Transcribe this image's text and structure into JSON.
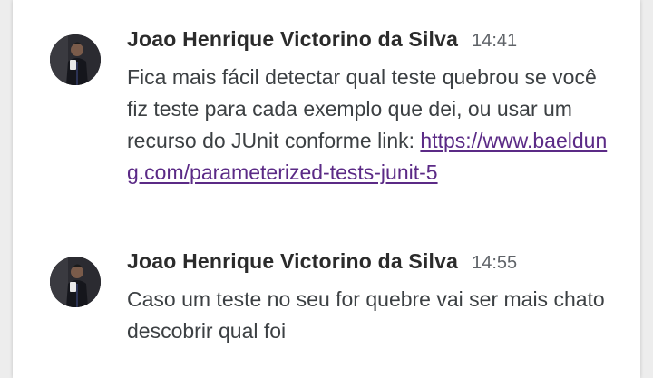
{
  "messages": [
    {
      "author": "Joao Henrique Victorino da Silva",
      "time": "14:41",
      "text": "Fica mais fácil detectar qual teste quebrou se você fiz teste para cada exemplo que dei, ou usar um recurso do JUnit conforme link: ",
      "link": "https://www.baeldung.com/parameterized-tests-junit-5",
      "avatar": "user-avatar"
    },
    {
      "author": "Joao Henrique Victorino da Silva",
      "time": "14:55",
      "text": "Caso um teste no seu for quebre vai ser mais chato descobrir qual foi",
      "avatar": "user-avatar"
    }
  ],
  "colors": {
    "link": "#5b2a86",
    "author": "#2b2b2b",
    "body_text": "#3c4043",
    "timestamp": "#5f6368"
  }
}
